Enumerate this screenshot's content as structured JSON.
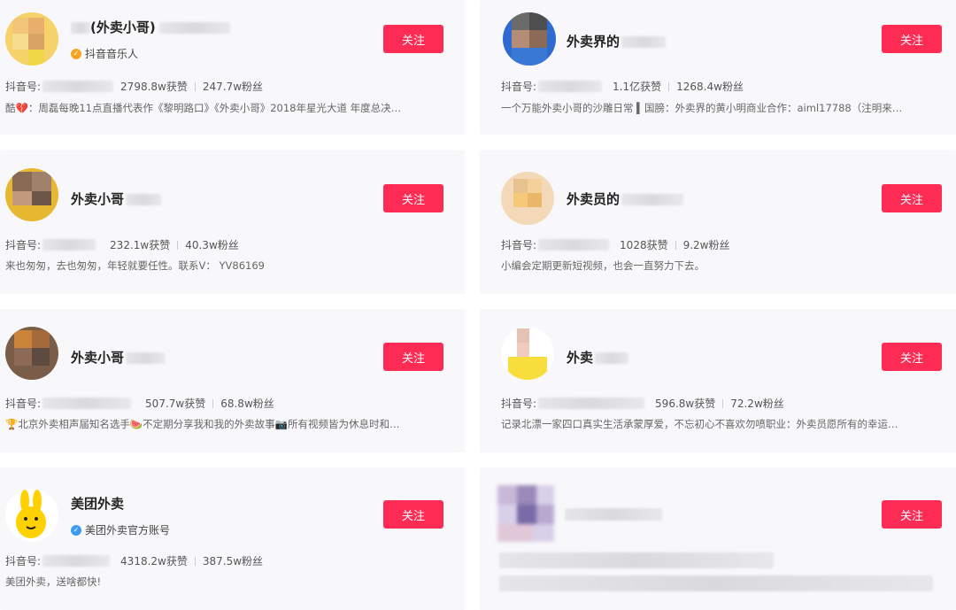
{
  "follow_label": "关注",
  "douyin_id_label": "抖音号:",
  "cards": [
    {
      "name": "(外卖小哥)",
      "verify": "抖音音乐人",
      "verify_color": "#f5a623",
      "likes": "2798.8w获赞",
      "fans": "247.7w粉丝",
      "desc": "酷💔：周磊每晚11点直播代表作《黎明路口》《外卖小哥》2018年星光大道 年度总决…"
    },
    {
      "name": "外卖界的",
      "likes": "1.1亿获赞",
      "fans": "1268.4w粉丝",
      "desc": "一个万能外卖小哥的沙雕日常 ▍国膀：外卖界的黄小明商业合作：aiml17788（注明来…"
    },
    {
      "name": "外卖小哥",
      "likes": "232.1w获赞",
      "fans": "40.3w粉丝",
      "desc": "来也匆匆，去也匆匆，年轻就要任性。联系V： YV86169"
    },
    {
      "name": "外卖员的",
      "likes": "1028获赞",
      "fans": "9.2w粉丝",
      "desc": "小编会定期更新短视频，也会一直努力下去。"
    },
    {
      "name": "外卖小哥",
      "likes": "507.7w获赞",
      "fans": "68.8w粉丝",
      "desc": "🏆北京外卖相声届知名选手🍉不定期分享我和我的外卖故事📷所有视频皆为休息时和…"
    },
    {
      "name": "外卖",
      "likes": "596.8w获赞",
      "fans": "72.2w粉丝",
      "desc": "记录北漂一家四口真实生活承蒙厚爱，不忘初心不喜欢勿喷职业：外卖员愿所有的幸运…"
    },
    {
      "name": "美团外卖",
      "verify": "美团外卖官方账号",
      "verify_color": "#3d9bf0",
      "likes": "4318.2w获赞",
      "fans": "387.5w粉丝",
      "desc": "美团外卖，送啥都快!"
    },
    {
      "name": "",
      "likes": "",
      "fans": "",
      "desc": ""
    }
  ],
  "colors": {
    "accent": "#fe2c55",
    "card_bg": "#f8f8fb"
  }
}
